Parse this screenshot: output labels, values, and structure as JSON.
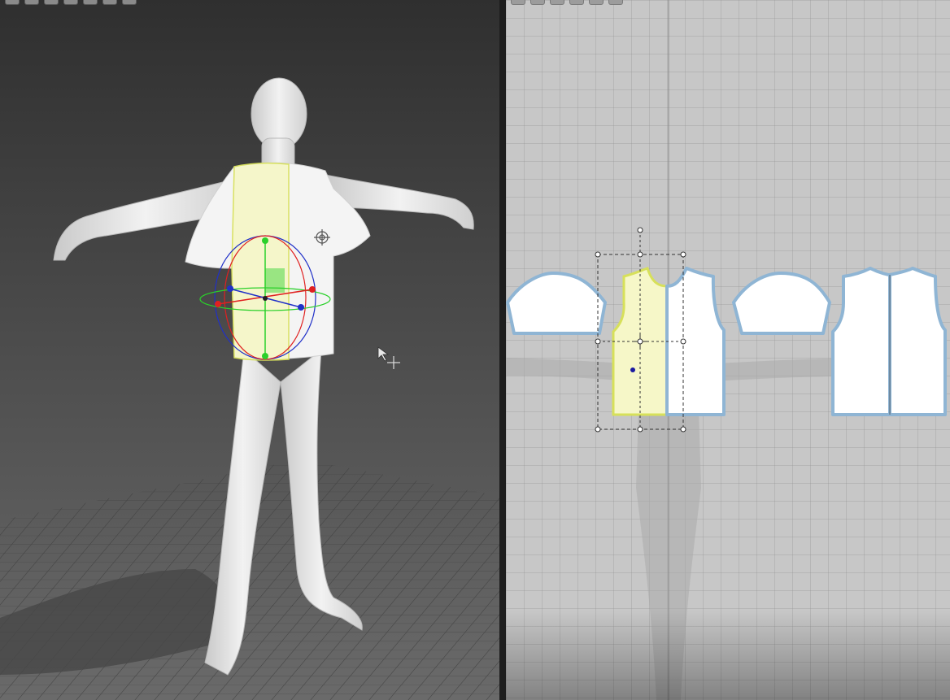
{
  "viewport_3d": {
    "toolbar": [
      "display-mode-icon",
      "layer-icon",
      "view-icon",
      "camera-icon",
      "avatar-icon",
      "texture-icon",
      "render-icon"
    ]
  },
  "viewport_2d": {
    "toolbar": [
      "transform-pattern-icon",
      "edit-point-icon",
      "edit-curve-icon",
      "segment-icon",
      "internal-line-icon",
      "trace-icon"
    ],
    "pieces": [
      "left-sleeve",
      "front-bodice",
      "right-sleeve",
      "back-bodice"
    ]
  },
  "colors": {
    "selected_fill": "#f6f7c8",
    "selected_outline": "#d7e05a",
    "piece_outline": "#8fb5d4",
    "gizmo_red": "#e02020",
    "gizmo_green": "#2ad02a",
    "gizmo_blue": "#2030c8"
  }
}
